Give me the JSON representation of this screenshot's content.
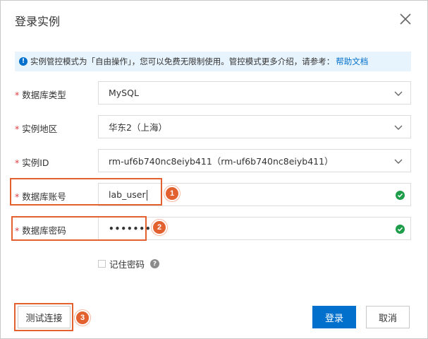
{
  "dialog": {
    "title": "登录实例",
    "notice": {
      "text": "实例管控模式为「自由操作」，您可以免费无限制使用。管控模式更多介绍，请参考：",
      "link_label": "帮助文档"
    },
    "required_mark": "*",
    "rows": {
      "db_type": {
        "label": "数据库类型",
        "value": "MySQL"
      },
      "region": {
        "label": "实例地区",
        "value": "华东2（上海）"
      },
      "instance_id": {
        "label": "实例ID",
        "value": "rm-uf6b740nc8eiyb411（rm-uf6b740nc8eiyb411）"
      },
      "account": {
        "label": "数据库账号",
        "value": "lab_user"
      },
      "password": {
        "label": "数据库密码",
        "value": "••••••••"
      }
    },
    "remember_label": "记住密码",
    "buttons": {
      "test": "测试连接",
      "login": "登录",
      "cancel": "取消"
    },
    "badges": [
      "1",
      "2",
      "3"
    ]
  },
  "colors": {
    "accent": "#0070cc",
    "highlight": "#e2612f",
    "success": "#1e9e4a",
    "required": "#e4393c",
    "notice_bg": "#e8f4fd"
  },
  "icons": {
    "close": "close-icon",
    "info": "info-icon",
    "chevron": "chevron-down-icon",
    "check": "check-circle-icon",
    "help": "help-icon"
  }
}
